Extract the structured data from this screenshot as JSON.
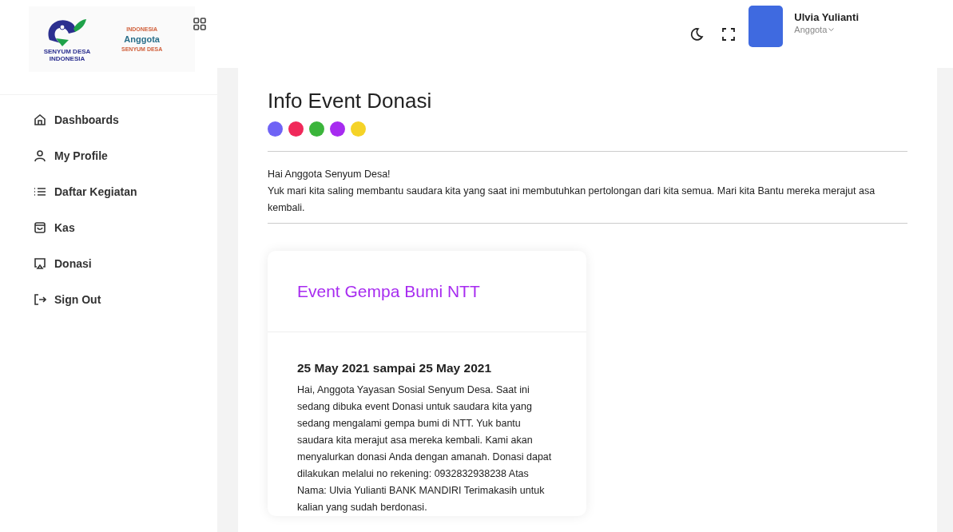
{
  "sidebar": {
    "logo": {
      "mark_text": [
        "SENYUM DESA",
        "INDONESIA"
      ],
      "lines": [
        "INDONESIA",
        "Anggota",
        "SENYUM DESA"
      ]
    },
    "items": [
      {
        "label": "Dashboards",
        "kind": "home",
        "selected": false
      },
      {
        "label": "My Profile",
        "kind": "user",
        "selected": false
      },
      {
        "label": "Daftar Kegiatan",
        "kind": "list",
        "selected": false
      },
      {
        "label": "Kas",
        "kind": "bag",
        "selected": false
      },
      {
        "label": "Donasi",
        "kind": "screen",
        "selected": false
      },
      {
        "label": "Sign Out",
        "kind": "logout",
        "selected": false
      }
    ]
  },
  "header": {
    "user": {
      "name": "Ulvia Yulianti",
      "role": "Anggota"
    }
  },
  "page": {
    "title": "Info Event Donasi",
    "dots": [
      {
        "color": "#6f63f5"
      },
      {
        "color": "#f0295a"
      },
      {
        "color": "#3bb53b"
      },
      {
        "color": "#a72bf0"
      },
      {
        "color": "#f5d327"
      }
    ],
    "intro": [
      "Hai Anggota Senyum Desa!",
      "Yuk mari kita saling membantu saudara kita yang saat ini membutuhkan pertolongan dari kita semua. Mari kita Bantu mereka merajut asa kembali."
    ],
    "event": {
      "title": "Event Gempa Bumi NTT",
      "date": "25 May 2021 sampai 25 May 2021",
      "body": "Hai, Anggota Yayasan Sosial Senyum Desa. Saat ini sedang dibuka event Donasi untuk saudara kita yang sedang mengalami gempa bumi di NTT. Yuk bantu saudara kita merajut asa mereka kembali. Kami akan menyalurkan donasi Anda dengan amanah. Donasi dapat dilakukan melalui no rekening: 0932832938238 Atas Nama: Ulvia Yulianti BANK MANDIRI Terimakasih untuk kalian yang sudah berdonasi."
    }
  }
}
